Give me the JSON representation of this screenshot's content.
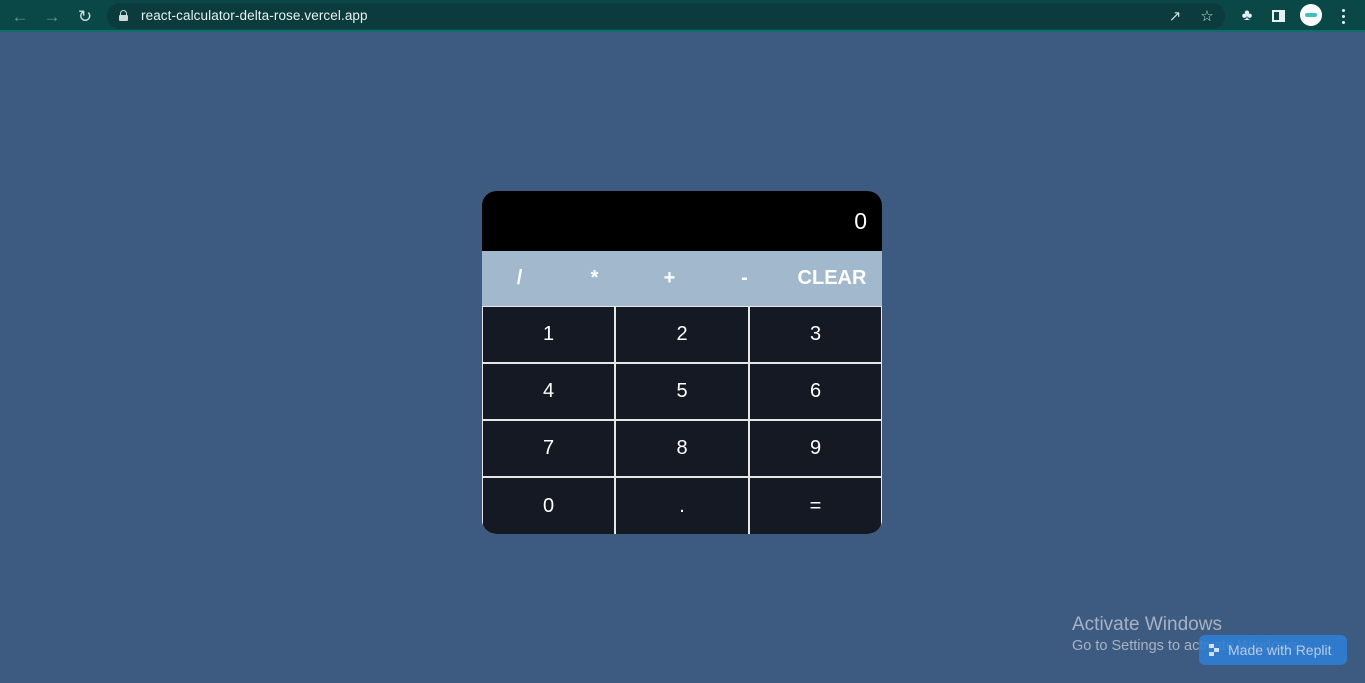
{
  "browser": {
    "url": "react-calculator-delta-rose.vercel.app",
    "icons": [
      "back-arrow-icon",
      "forward-arrow-icon",
      "reload-icon",
      "lock-icon",
      "share-icon",
      "star-icon",
      "puzzle-icon",
      "side-panel-icon",
      "avatar",
      "kebab-menu-icon"
    ]
  },
  "calculator": {
    "display": "0",
    "operators": [
      "/",
      "*",
      "+",
      "-"
    ],
    "clear_label": "CLEAR",
    "keys": [
      [
        "1",
        "2",
        "3"
      ],
      [
        "4",
        "5",
        "6"
      ],
      [
        "7",
        "8",
        "9"
      ],
      [
        "0",
        ".",
        "="
      ]
    ],
    "colors": {
      "page_background": "#3d5a80",
      "display_background": "#000000",
      "operator_bar": "#a2b8cd",
      "key_background": "#141923"
    }
  },
  "watermark": {
    "line1": "Activate Windows",
    "line2": "Go to Settings to activate Windows."
  },
  "badge": {
    "label": "Made with Replit"
  }
}
